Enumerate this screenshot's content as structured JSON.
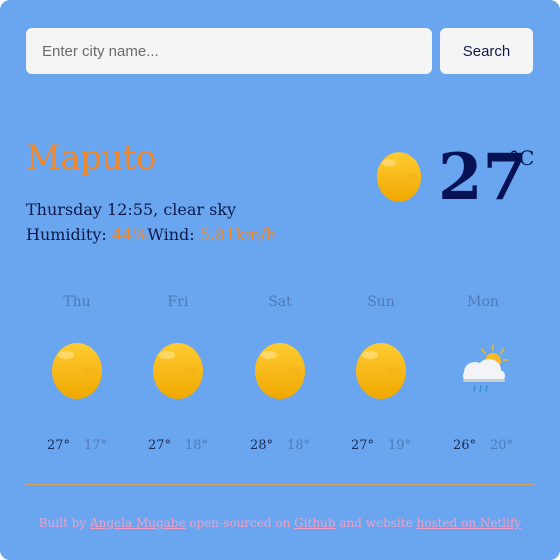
{
  "search": {
    "placeholder": "Enter city name...",
    "value": "",
    "button_label": "Search"
  },
  "current": {
    "city": "Maputo",
    "day_time": "Thursday 12:55",
    "condition": "clear sky",
    "humidity_label": "Humidity:",
    "humidity_value": "44%",
    "wind_label": "Wind:",
    "wind_value": "5.81km/h",
    "temperature": "27",
    "unit": "°C",
    "icon": "sun-icon"
  },
  "forecast": [
    {
      "day": "Thu",
      "max": "27°",
      "min": "17°",
      "icon": "sun-icon"
    },
    {
      "day": "Fri",
      "max": "27°",
      "min": "18°",
      "icon": "sun-icon"
    },
    {
      "day": "Sat",
      "max": "28°",
      "min": "18°",
      "icon": "sun-icon"
    },
    {
      "day": "Sun",
      "max": "27°",
      "min": "19°",
      "icon": "sun-icon"
    },
    {
      "day": "Mon",
      "max": "26°",
      "min": "20°",
      "icon": "sun-cloud-rain-icon"
    }
  ],
  "footer": {
    "built_by": "Built by",
    "author": "Angela Mugabe",
    "open_sourced": "open-sourced on",
    "github": "Github",
    "and_website": "and website",
    "hosted": "hosted on Netlify"
  },
  "colors": {
    "background": "#6aa6ef",
    "accent": "#f08a2c",
    "text_dark": "#061254",
    "muted": "#4f79b8",
    "footer": "#f0a0c8"
  }
}
